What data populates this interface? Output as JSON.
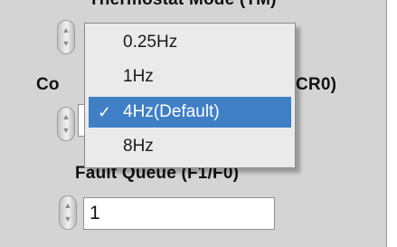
{
  "labels": {
    "thermostat_mode": "Thermostat Mode (TM)",
    "conversion_left": "Co",
    "conversion_right": "CR0)",
    "fault_queue": "Fault Queue (F1/F0)"
  },
  "dropdown": {
    "items": [
      {
        "label": "0.25Hz",
        "checked": false
      },
      {
        "label": "1Hz",
        "checked": false
      },
      {
        "label": "4Hz(Default)",
        "checked": true
      },
      {
        "label": "8Hz",
        "checked": false
      }
    ],
    "check_glyph": "✓",
    "selected_color": "#3f7fc6"
  },
  "fault_queue": {
    "value": "1"
  },
  "icons": {
    "stepper": "ring-stepper-icon",
    "up_arrow": "▲",
    "down_arrow": "▼"
  }
}
